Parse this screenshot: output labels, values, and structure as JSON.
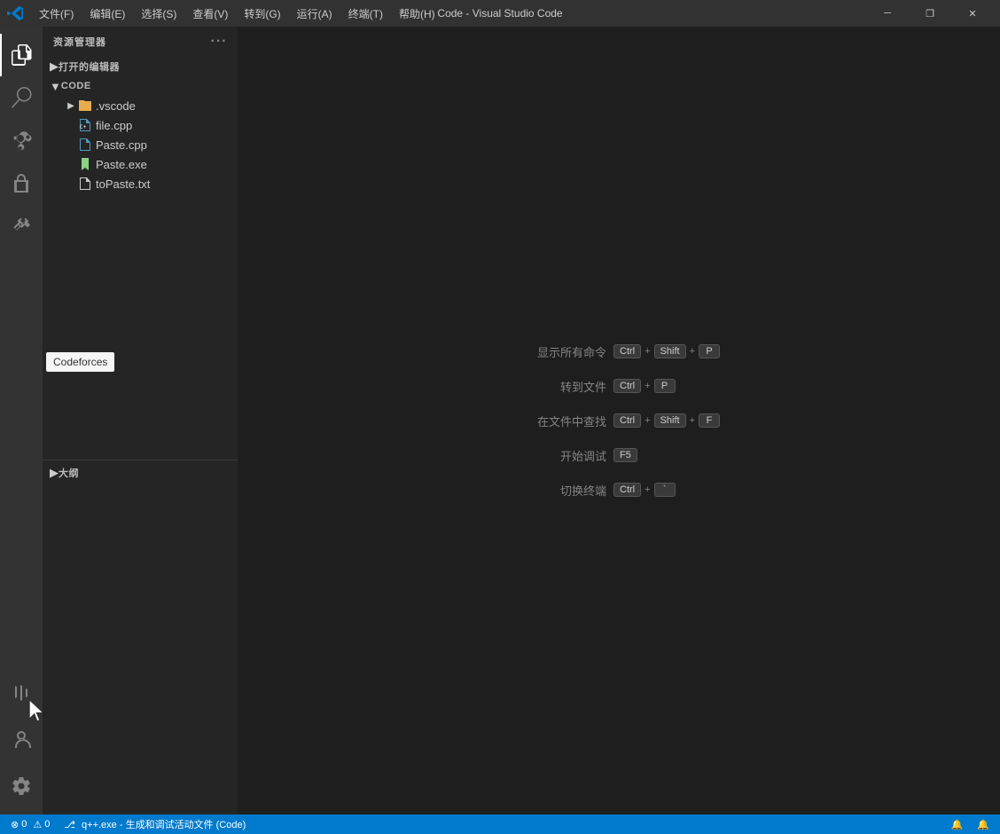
{
  "titleBar": {
    "title": "Code - Visual Studio Code",
    "menus": [
      "文件(F)",
      "编辑(E)",
      "选择(S)",
      "查看(V)",
      "转到(G)",
      "运行(A)",
      "终端(T)",
      "帮助(H)"
    ],
    "buttons": [
      "—",
      "❐",
      "✕"
    ]
  },
  "activityBar": {
    "items": [
      {
        "id": "explorer",
        "icon": "files-icon",
        "label": "资源管理器",
        "active": true
      },
      {
        "id": "search",
        "icon": "search-icon",
        "label": "搜索"
      },
      {
        "id": "git",
        "icon": "git-icon",
        "label": "源代码管理"
      },
      {
        "id": "debug",
        "icon": "debug-icon",
        "label": "运行和调试"
      },
      {
        "id": "extensions",
        "icon": "extensions-icon",
        "label": "扩展"
      }
    ],
    "bottomItems": [
      {
        "id": "codeforces",
        "icon": "codeforces-icon",
        "label": "Codeforces",
        "active": false
      },
      {
        "id": "account",
        "icon": "account-icon",
        "label": "帐户"
      },
      {
        "id": "settings",
        "icon": "settings-icon",
        "label": "设置"
      }
    ]
  },
  "sidebar": {
    "title": "资源管理器",
    "sections": {
      "openEditors": {
        "label": "打开的编辑器",
        "expanded": false
      },
      "code": {
        "label": "CODE",
        "expanded": true,
        "items": [
          {
            "name": ".vscode",
            "type": "folder",
            "indent": 1
          },
          {
            "name": "file.cpp",
            "type": "cpp",
            "indent": 1
          },
          {
            "name": "Paste.cpp",
            "type": "cpp",
            "indent": 1
          },
          {
            "name": "Paste.exe",
            "type": "exe",
            "indent": 1
          },
          {
            "name": "toPaste.txt",
            "type": "txt",
            "indent": 1
          }
        ]
      },
      "outline": {
        "label": "大纲"
      }
    }
  },
  "tooltip": {
    "text": "Codeforces"
  },
  "editor": {
    "shortcuts": [
      {
        "label": "显示所有命令",
        "keys": [
          "Ctrl",
          "+",
          "Shift",
          "+",
          "P"
        ]
      },
      {
        "label": "转到文件",
        "keys": [
          "Ctrl",
          "+",
          "P"
        ]
      },
      {
        "label": "在文件中查找",
        "keys": [
          "Ctrl",
          "+",
          "Shift",
          "+",
          "F"
        ]
      },
      {
        "label": "开始调试",
        "keys": [
          "F5"
        ]
      },
      {
        "label": "切换终端",
        "keys": [
          "Ctrl",
          "+",
          "`"
        ]
      }
    ]
  },
  "statusBar": {
    "left": [
      {
        "text": "⊗ 0  ⚠ 0"
      },
      {
        "text": "⎇  q++.exe - 生成和调试活动文件 (Code)"
      }
    ],
    "right": [
      {
        "text": "🔔"
      },
      {
        "text": "🔔"
      }
    ]
  }
}
